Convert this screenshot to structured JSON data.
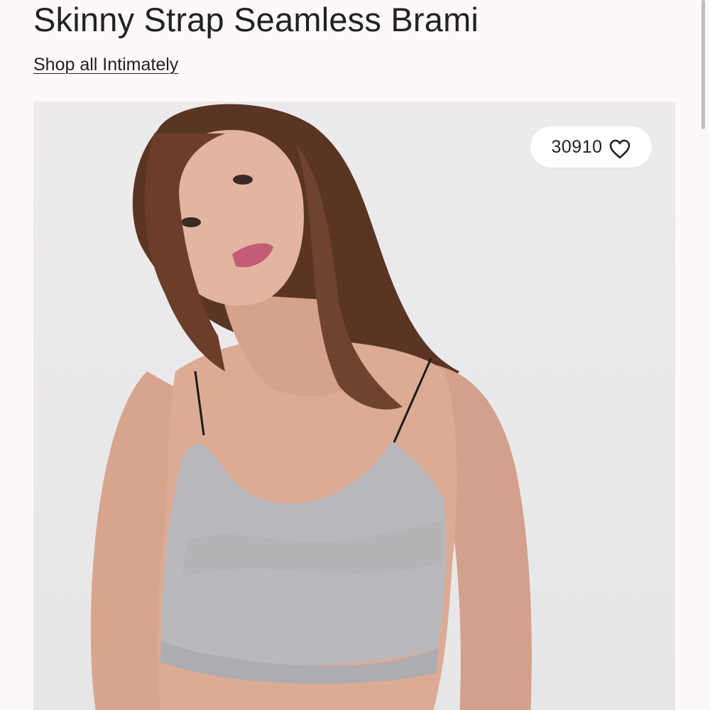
{
  "product": {
    "title": "Skinny Strap Seamless Brami",
    "shop_all_link": "Shop all Intimately"
  },
  "image": {
    "alt": "",
    "likes": {
      "count": "30910",
      "icon": "heart-outline-icon"
    }
  },
  "colors": {
    "background": "#fcf9f8",
    "text": "#222222",
    "photo_backdrop": "#eceaec",
    "garment": "#b9b8bc"
  }
}
